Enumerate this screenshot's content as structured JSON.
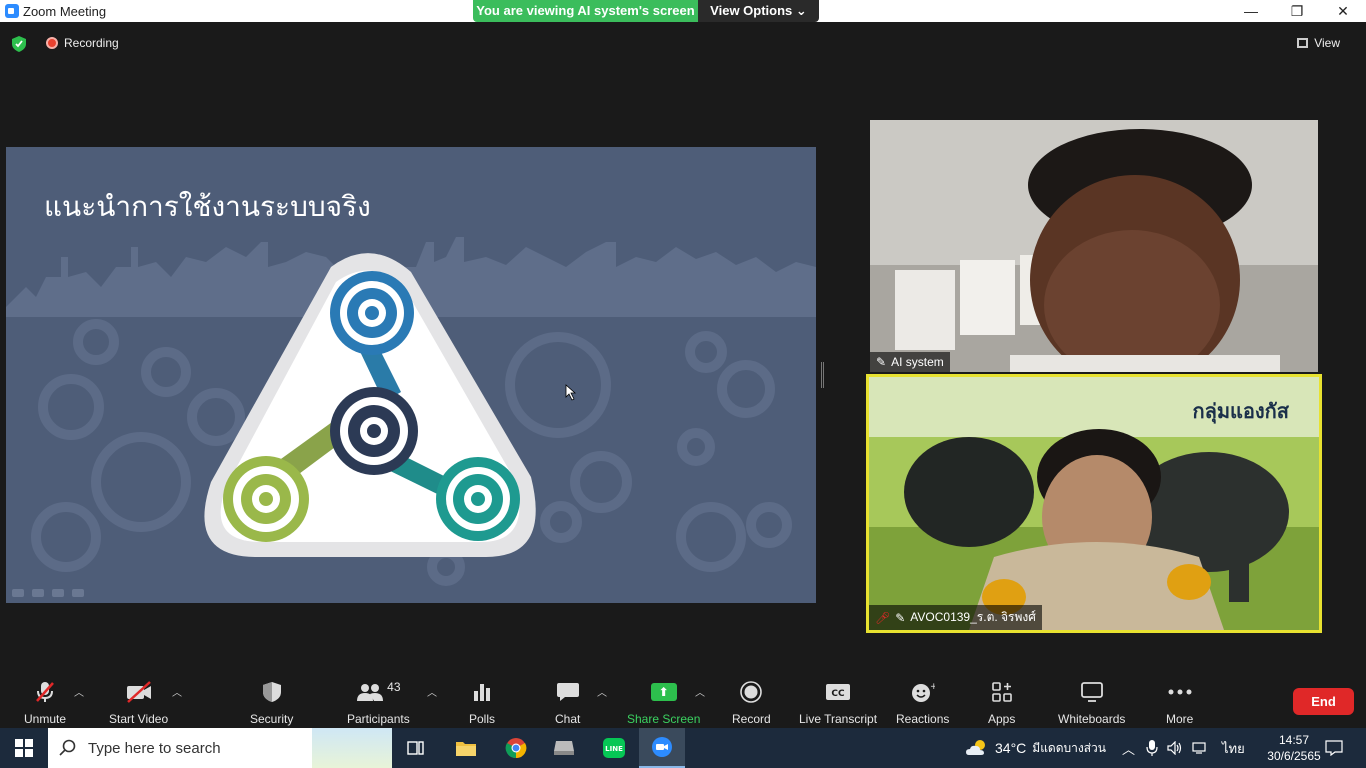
{
  "window": {
    "title": "Zoom Meeting",
    "share_banner": "You are viewing AI system's screen",
    "view_options": "View Options",
    "controls": [
      "minimize",
      "restore",
      "close"
    ]
  },
  "meeting": {
    "recording_label": "Recording",
    "view_label": "View",
    "slide_title": "แนะนำการใช้งานระบบจริง"
  },
  "participants": [
    {
      "name": "AI system",
      "muted": false
    },
    {
      "name": "AVOC0139_ร.ต. จิรพงศ์",
      "muted": true,
      "background_text": "กลุ่มแองกัส"
    }
  ],
  "toolbar": {
    "unmute": "Unmute",
    "start_video": "Start Video",
    "security": "Security",
    "participants": "Participants",
    "participants_count": "43",
    "polls": "Polls",
    "chat": "Chat",
    "share_screen": "Share Screen",
    "record": "Record",
    "live_transcript": "Live Transcript",
    "reactions": "Reactions",
    "apps": "Apps",
    "whiteboards": "Whiteboards",
    "more": "More",
    "end": "End"
  },
  "taskbar": {
    "search_placeholder": "Type here to search",
    "weather_temp": "34°C",
    "weather_text": "มีแดดบางส่วน",
    "language": "ไทย",
    "time": "14:57",
    "date": "30/6/2565"
  },
  "colors": {
    "share_green": "#3bbd5c",
    "end_red": "#e02828",
    "slide_bg": "#4e5d78",
    "active_speaker": "#e8e230"
  }
}
